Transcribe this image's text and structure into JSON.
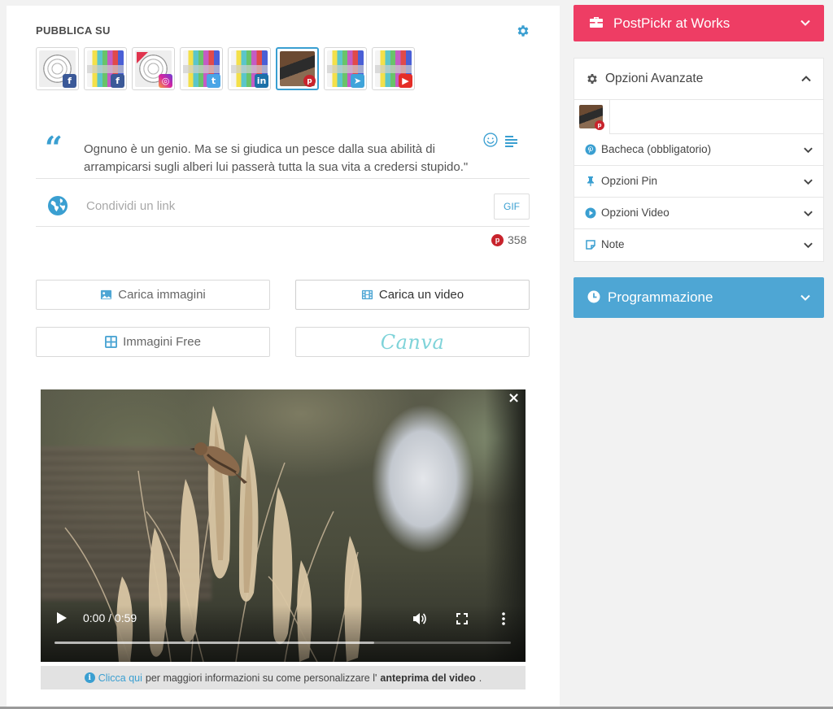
{
  "publish": {
    "title": "PUBBLICA SU",
    "accounts": [
      {
        "avatar": "target-logo",
        "network": "facebook",
        "badge_glyph": "f"
      },
      {
        "avatar": "test-pattern",
        "network": "facebook",
        "badge_glyph": "f"
      },
      {
        "avatar": "target-logo",
        "network": "instagram",
        "badge_glyph": "◎"
      },
      {
        "avatar": "test-pattern",
        "network": "twitter",
        "badge_glyph": "t"
      },
      {
        "avatar": "test-pattern",
        "network": "linkedin",
        "badge_glyph": "in"
      },
      {
        "avatar": "photo-portrait",
        "network": "pinterest",
        "badge_glyph": "p",
        "selected": true
      },
      {
        "avatar": "test-pattern",
        "network": "telegram",
        "badge_glyph": "➤"
      },
      {
        "avatar": "test-pattern",
        "network": "youtube",
        "badge_glyph": "▶"
      }
    ]
  },
  "post": {
    "text": "Ognuno è un genio. Ma se si giudica un pesce dalla sua abilità di arrampicarsi sugli alberi lui passerà tutta la sua vita a credersi stupido.\"",
    "quote_glyph": "“",
    "link_placeholder": "Condividi un link",
    "gif_label": "GIF",
    "char_counter": "358"
  },
  "upload_buttons": {
    "images": "Carica immagini",
    "video": "Carica un video",
    "free_images": "Immagini Free",
    "canva": "Canva"
  },
  "video_player": {
    "time": "0:00 / 0:59",
    "buffered_fraction": 0.7,
    "close_glyph": "×"
  },
  "video_info": {
    "link_text": "Clicca qui",
    "text_middle": "per maggiori informazioni su come personalizzare l'",
    "bold_text": "anteprima del video",
    "text_end": "."
  },
  "sidebar": {
    "works_label": "PostPickr at Works",
    "advanced_label": "Opzioni Avanzate",
    "options": [
      {
        "label": "Bacheca (obbligatorio)",
        "icon": "pinterest-icon"
      },
      {
        "label": "Opzioni Pin",
        "icon": "pushpin-icon"
      },
      {
        "label": "Opzioni Video",
        "icon": "play-circle-icon"
      },
      {
        "label": "Note",
        "icon": "note-icon"
      }
    ],
    "schedule_label": "Programmazione"
  },
  "colors": {
    "accent": "#3a9fd1",
    "works": "#ee3d64",
    "schedule": "#4ea6d4",
    "pinterest": "#c8232c"
  }
}
